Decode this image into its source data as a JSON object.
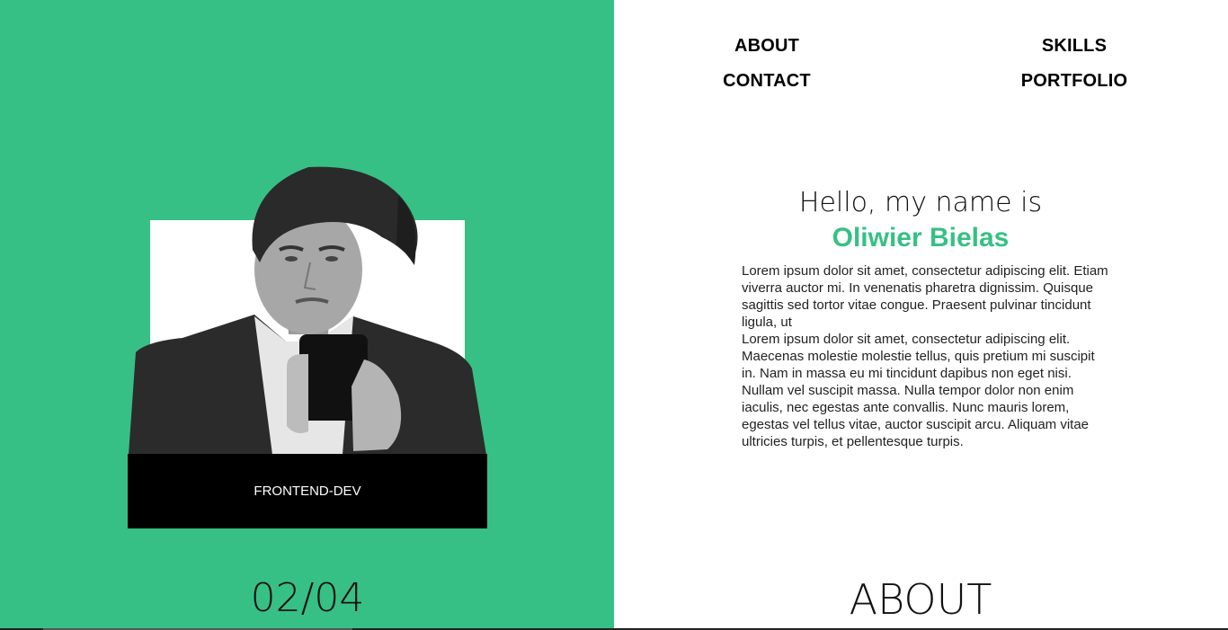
{
  "nav": {
    "about": "ABOUT",
    "skills": "SKILLS",
    "contact": "CONTACT",
    "portfolio": "PORTFOLIO"
  },
  "profile": {
    "role": "FRONTEND-DEV",
    "counter": "02/04"
  },
  "intro": {
    "greeting": "Hello, my name is",
    "name": "Oliwier Bielas",
    "paragraph_1": "Lorem ipsum dolor sit amet, consectetur adipiscing elit. Etiam viverra auctor mi. In venenatis pharetra dignissim. Quisque sagittis sed tortor vitae congue. Praesent pulvinar tincidunt ligula, ut",
    "paragraph_2": "Lorem ipsum dolor sit amet, consectetur adipiscing elit. Maecenas molestie molestie tellus, quis pretium mi suscipit in. Nam in massa eu mi tincidunt dapibus non eget nisi. Nullam vel suscipit massa. Nulla tempor dolor non enim iaculis, nec egestas ante convallis. Nunc mauris lorem, egestas vel tellus vitae, auctor suscipit arcu. Aliquam vitae ultricies turpis, et pellentesque turpis."
  },
  "section": {
    "title": "ABOUT"
  },
  "colors": {
    "accent": "#37c085",
    "dark": "#000000",
    "light": "#ffffff"
  }
}
